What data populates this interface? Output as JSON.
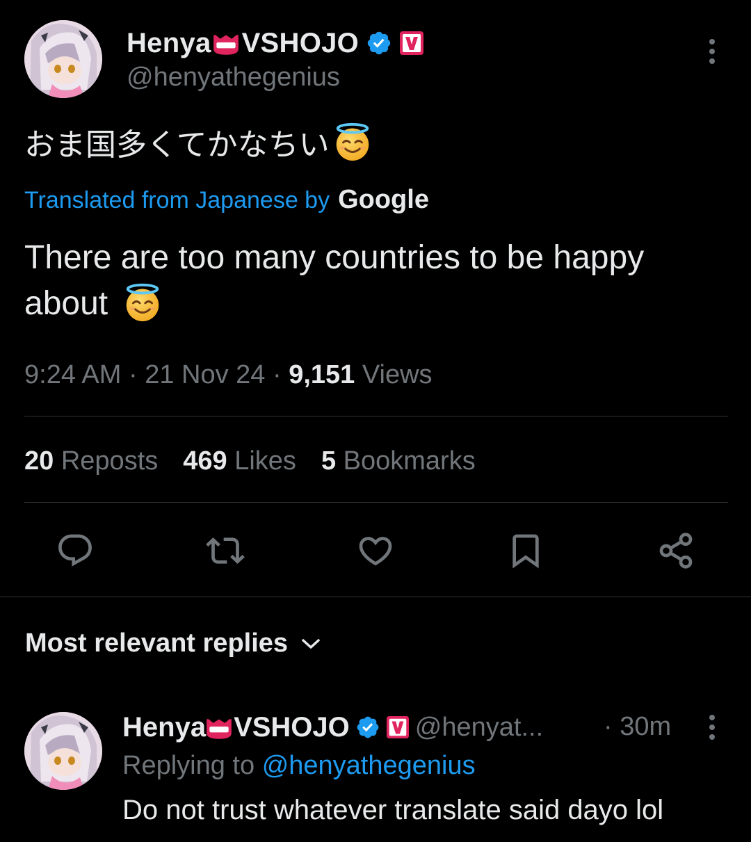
{
  "tweet": {
    "display_name_part1": "Henya",
    "display_name_part2": "VSHOJO",
    "handle": "@henyathegenius",
    "original_text": "おま国多くてかなちい",
    "translated_label": "Translated from Japanese by",
    "translator": "Google",
    "translation": "There are too many countries to be happy about",
    "time": "9:24 AM",
    "date": "21 Nov 24",
    "views_count": "9,151",
    "views_label": "Views",
    "reposts_count": "20",
    "reposts_label": "Reposts",
    "likes_count": "469",
    "likes_label": "Likes",
    "bookmarks_count": "5",
    "bookmarks_label": "Bookmarks",
    "separator": "·"
  },
  "replies_section": {
    "title": "Most relevant replies"
  },
  "reply": {
    "display_name_part1": "Henya",
    "display_name_part2": "VSHOJO",
    "handle": "@henyat...",
    "time": "30m",
    "replying_to_label": "Replying to",
    "replying_to_handle": "@henyathegenius",
    "text": "Do not trust whatever translate said dayo lol"
  },
  "icons": {
    "verified": "verified-badge-icon",
    "affiliate": "vshojo-affiliate-icon",
    "crown": "mouth-emoji-icon",
    "halo": "smiling-face-with-halo-icon",
    "more": "more-vertical-icon",
    "reply": "reply-icon",
    "repost": "repost-icon",
    "like": "heart-icon",
    "bookmark": "bookmark-icon",
    "share": "share-icon",
    "chevron": "chevron-down-icon"
  },
  "colors": {
    "background": "#000000",
    "text": "#e7e9ea",
    "secondary": "#71767b",
    "accent": "#1d9bf0",
    "divider": "#2f3336",
    "affiliate_badge": "#e0245e"
  }
}
